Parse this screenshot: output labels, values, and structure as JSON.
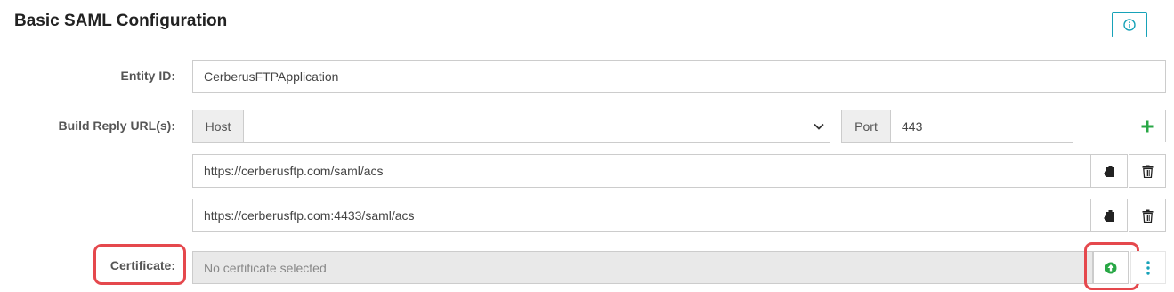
{
  "section": {
    "title": "Basic SAML Configuration"
  },
  "entity_id": {
    "label": "Entity ID:",
    "value": "CerberusFTPApplication"
  },
  "reply_urls": {
    "label": "Build Reply URL(s):",
    "host_addon": "Host",
    "host_value": "",
    "port_addon": "Port",
    "port_value": "443",
    "urls": [
      "https://cerberusftp.com/saml/acs",
      "https://cerberusftp.com:4433/saml/acs"
    ]
  },
  "certificate": {
    "label": "Certificate:",
    "placeholder": "No certificate selected"
  },
  "icons": {
    "info": "info-circle-icon",
    "add": "plus-icon",
    "copy": "clipboard-icon",
    "delete": "trash-icon",
    "upload": "upload-circle-icon",
    "more": "vertical-ellipsis-icon"
  },
  "colors": {
    "info_accent": "#17a2b8",
    "add_green": "#28a745",
    "highlight_red": "#e5484d"
  }
}
